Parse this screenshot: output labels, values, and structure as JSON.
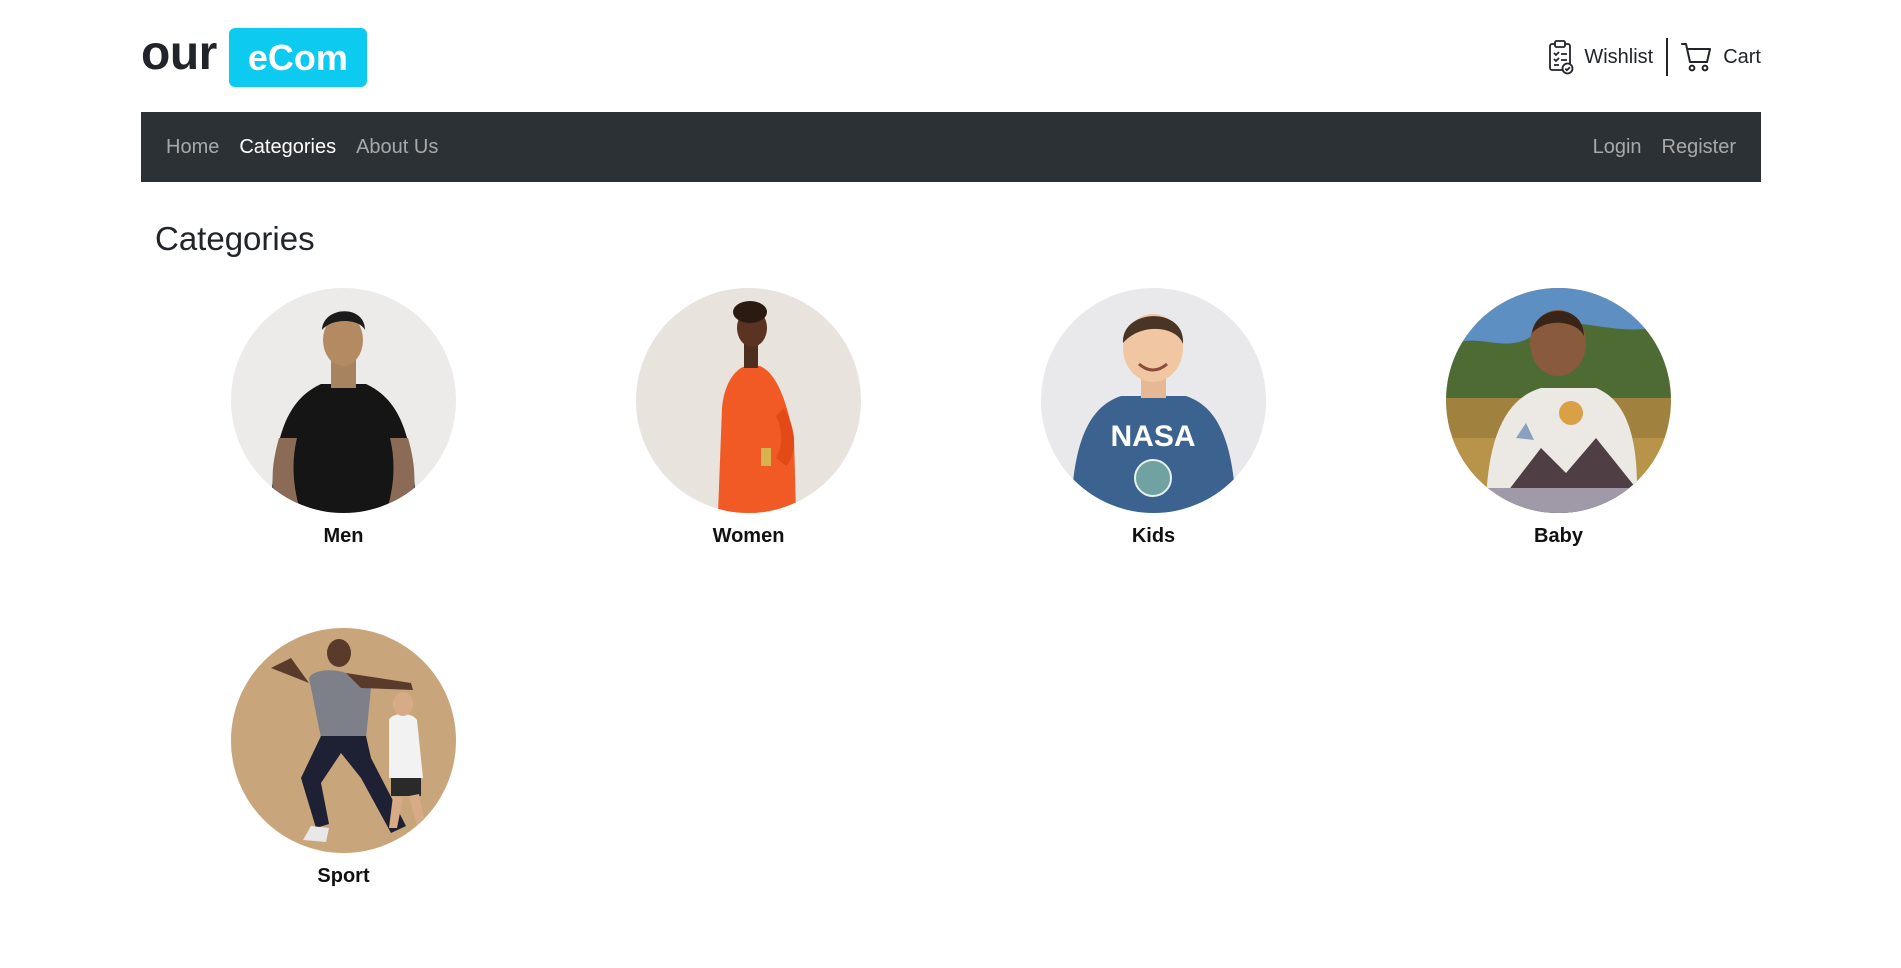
{
  "header": {
    "logo_text": "our",
    "logo_badge": "eCom",
    "wishlist_label": "Wishlist",
    "cart_label": "Cart",
    "wishlist_icon": "clipboard-check-icon",
    "cart_icon": "cart-icon"
  },
  "nav": {
    "left": [
      {
        "label": "Home",
        "active": false
      },
      {
        "label": "Categories",
        "active": true
      },
      {
        "label": "About Us",
        "active": false
      }
    ],
    "right": [
      {
        "label": "Login"
      },
      {
        "label": "Register"
      }
    ]
  },
  "main": {
    "title": "Categories",
    "categories": [
      {
        "name": "Men",
        "image": "man-black-tshirt-photo"
      },
      {
        "name": "Women",
        "image": "woman-orange-dress-photo"
      },
      {
        "name": "Kids",
        "image": "boy-nasa-tshirt-photo"
      },
      {
        "name": "Baby",
        "image": "baby-sweater-field-photo"
      },
      {
        "name": "Sport",
        "image": "men-athletic-wear-photo"
      }
    ]
  },
  "colors": {
    "accent": "#0dcaf0",
    "navbar_bg": "#2c3135",
    "text": "#212529"
  }
}
